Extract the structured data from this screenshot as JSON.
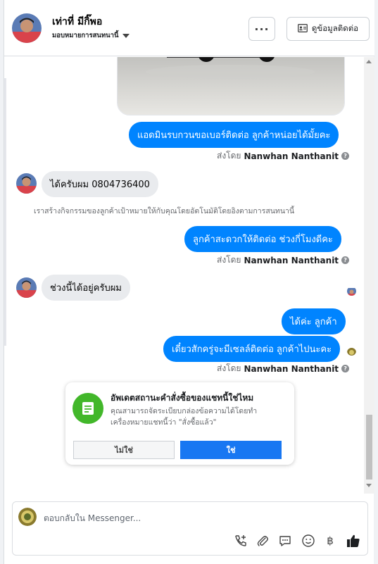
{
  "header": {
    "contact_name": "เท่าที่ มีกิ๊พอ",
    "assign_label": "มอบหมายการสนทนานี้",
    "more_label": "···",
    "contact_info_label": "ดูข้อมูลติดต่อ"
  },
  "thread": {
    "messages": [
      {
        "text": "แอดมินรบกวนขอเบอร์ติดต่อ ลูกค้าหน่อยได้มั้ยคะ"
      },
      {
        "text": "ได้ครับผม 0804736400"
      },
      {
        "text": "ลูกค้าสะดวกให้ติดต่อ ช่วงกี่โมงดีคะ"
      },
      {
        "text": "ช่วงนี้ได้อยู่ครับผม"
      },
      {
        "text": "ได้ค่ะ ลูกค้า"
      },
      {
        "text": "เดี๋ยวสักครู่จะมีเซลล์ติดต่อ ลูกค้าไปนะคะ"
      }
    ],
    "sent_by_prefix": "ส่งโดย",
    "sent_by_name": "Nanwhan Nanthanit",
    "system_note": "เราสร้างกิจกรรมของลูกค้าเป้าหมายให้กับคุณโดยอัตโนมัติโดยอิงตามการสนทนานี้"
  },
  "card": {
    "title": "อัพเดตสถานะคำสั่งซื้อของแชทนี้ใช่ไหม",
    "description": "คุณสามารถจัดระเบียบกล่องข้อความได้โดยทำเครื่องหมายแชทนี้ว่า \"สั่งซื้อแล้ว\"",
    "no_label": "ไม่ใช่",
    "yes_label": "ใช่"
  },
  "composer": {
    "placeholder": "ตอบกลับใน Messenger..."
  },
  "colors": {
    "accent": "#0084ff",
    "button_blue": "#1877f2",
    "card_icon_green": "#42b72a"
  },
  "icons": [
    "more-icon",
    "contact-card-icon",
    "info-icon",
    "order-icon",
    "call-add-icon",
    "attachment-icon",
    "saved-replies-icon",
    "emoji-icon",
    "payment-icon",
    "like-icon"
  ]
}
